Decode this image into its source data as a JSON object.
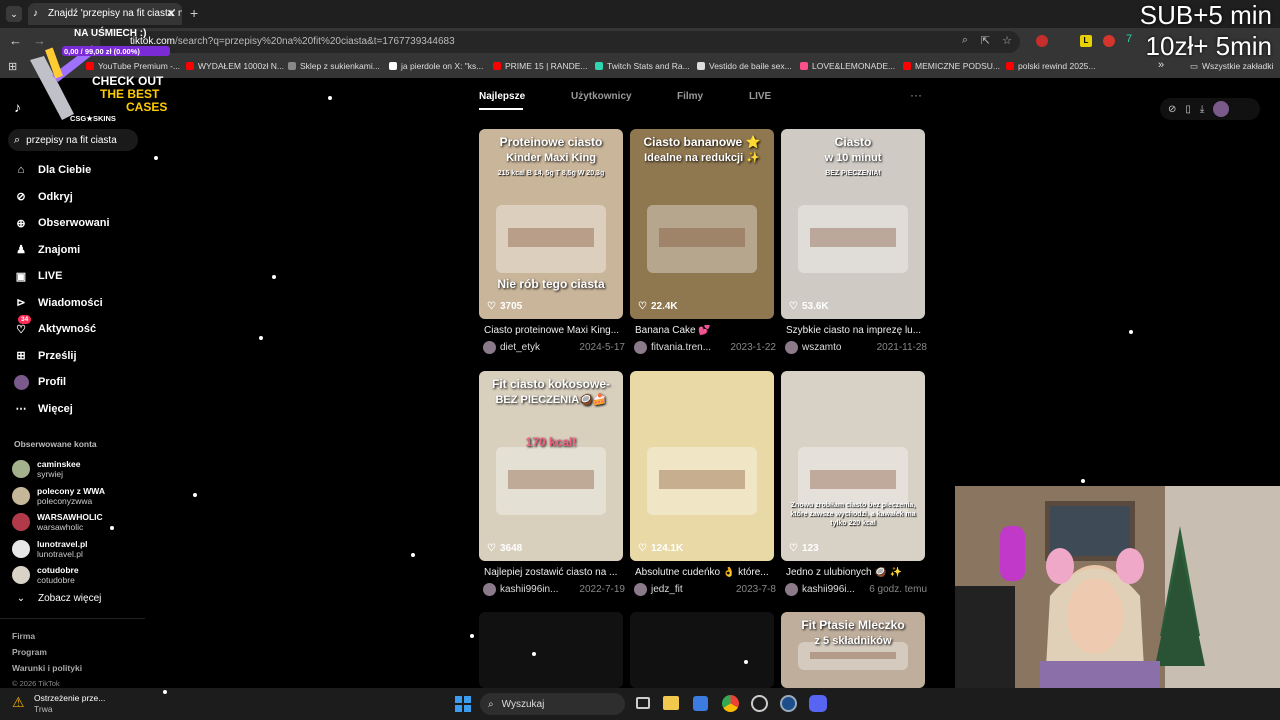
{
  "browser": {
    "tab_title": "Znajdź 'przepisy na fit ciasta' n",
    "url_host": "tiktok.com",
    "url_path": "search?q=przepisy%20na%20fit%20ciasta&t=1767739344683",
    "bookmarks": [
      {
        "label": "YouTube Premium -...",
        "color": "#ff0000"
      },
      {
        "label": "WYDAŁEM 1000zł N...",
        "color": "#ff0000"
      },
      {
        "label": "Sklep z sukienkami...",
        "color": "#888888"
      },
      {
        "label": "ja pierdole on X: \"ks...",
        "color": "#ffffff"
      },
      {
        "label": "PRIME 15 | RANDE...",
        "color": "#ff0000"
      },
      {
        "label": "Twitch Stats and Ra...",
        "color": "#2fd4b0"
      },
      {
        "label": "Vestido de baile sex...",
        "color": "#dddddd"
      },
      {
        "label": "LOVE&LEMONADE...",
        "color": "#ff4f8a"
      },
      {
        "label": "MEMICZNE PODSU...",
        "color": "#ff0000"
      },
      {
        "label": "polski rewind 2025...",
        "color": "#ff0000"
      }
    ],
    "all_bookmarks": "Wszystkie zakładki"
  },
  "overlay": {
    "sub_line1": "SUB+5 min",
    "sub_line2": "10zł+ 5min",
    "promo_title": "NA UŚMIECH :)",
    "promo_amount": "0,00 / 99,00 zł (0.00%)",
    "promo_check": "CHECK OUT",
    "promo_best": "THE BEST",
    "promo_cases": "CASES",
    "promo_brand": "CSG★SKINS"
  },
  "search": {
    "query": "przepisy na fit ciasta"
  },
  "nav": [
    {
      "label": "Dla Ciebie"
    },
    {
      "label": "Odkryj"
    },
    {
      "label": "Obserwowani"
    },
    {
      "label": "Znajomi"
    },
    {
      "label": "LIVE"
    },
    {
      "label": "Wiadomości"
    },
    {
      "label": "Aktywność",
      "badge": "34"
    },
    {
      "label": "Prześlij"
    },
    {
      "label": "Profil"
    },
    {
      "label": "Więcej"
    }
  ],
  "following_heading": "Obserwowane konta",
  "following": [
    {
      "name": "caminskee",
      "handle": "syrwiej",
      "color": "#a3b28c"
    },
    {
      "name": "polecony z WWA",
      "handle": "poleconyzwwa",
      "color": "#c7b79a"
    },
    {
      "name": "WARSAWHOLIC",
      "handle": "warsawholic",
      "color": "#b03a4a"
    },
    {
      "name": "lunotravel.pl",
      "handle": "lunotravel.pl",
      "color": "#e7e7e7"
    },
    {
      "name": "cotudobre",
      "handle": "cotudobre",
      "color": "#d9d2c7"
    }
  ],
  "see_more": "Zobacz więcej",
  "footer": [
    "Firma",
    "Program",
    "Warunki i polityki",
    "© 2026 TikTok"
  ],
  "search_tabs": [
    "Najlepsze",
    "Użytkownicy",
    "Filmy",
    "LIVE"
  ],
  "results": [
    {
      "likes": "3705",
      "title": "Ciasto proteinowe Maxi King...",
      "author": "diet_etyk",
      "date": "2024-5-17",
      "bg": "#c9b59a",
      "overlay_top": "Proteinowe ciasto",
      "overlay_top2": "Kinder Maxi King",
      "overlay_small": "215 kcal B 14, 5g T 8,5g W 20,3g",
      "overlay_bottom": "Nie rób tego ciasta"
    },
    {
      "likes": "22.4K",
      "title": "Banana Cake 💕",
      "author": "fitvania.tren...",
      "date": "2023-1-22",
      "bg": "#8f7750",
      "overlay_top": "Ciasto bananowe ⭐",
      "overlay_top2": "Idealne na redukcji ✨"
    },
    {
      "likes": "53.6K",
      "title": "Szybkie ciasto na imprezę lu...",
      "author": "wszamto",
      "date": "2021-11-28",
      "bg": "#cfcbc4",
      "overlay_top": "Ciasto",
      "overlay_top2": "w 10 minut",
      "overlay_small": "BEZ PIECZENIA!"
    },
    {
      "likes": "3648",
      "title": "Najlepiej zostawić ciasto na ...",
      "author": "kashii996in...",
      "date": "2022-7-19",
      "bg": "#d8cfbd",
      "overlay_top": "Fit ciasto kokosowe-",
      "overlay_top2": "BEZ PIECZENIA🥥🍰",
      "overlay_bottom": "170 kcal!"
    },
    {
      "likes": "124.1K",
      "title": "Absolutne cudeńko 👌 które...",
      "author": "jedz_fit",
      "date": "2023-7-8",
      "bg": "#e8d9a6"
    },
    {
      "likes": "123",
      "title": "Jedno z ulubionych 🥥 ✨",
      "author": "kashii996i...",
      "date": "6 godz. temu",
      "bg": "#d8d2c6",
      "overlay_small": "Znowu zrobiłam ciasto bez pieczenia, które zawsze wychodzi, a kawałek ma tylko 220 kcal"
    },
    {
      "bg": "#111111"
    },
    {
      "bg": "#111111"
    },
    {
      "bg": "#bfae9c",
      "overlay_top": "Fit Ptasie Mleczko",
      "overlay_top2": "z 5 składników"
    }
  ],
  "taskbar": {
    "search_placeholder": "Wyszukaj",
    "notification_title": "Ostrzeżenie prze...",
    "notification_sub": "Trwa"
  }
}
